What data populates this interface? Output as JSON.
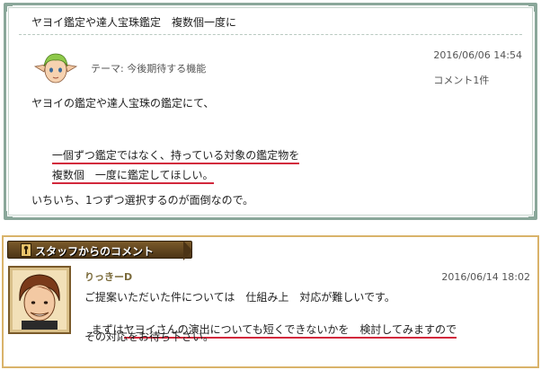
{
  "post": {
    "title": "ヤヨイ鑑定や達人宝珠鑑定　複数個一度に",
    "date": "2016/06/06 14:54",
    "comments": "コメント1件",
    "theme_label": "テーマ:",
    "theme_value": "今後期待する機能",
    "lines": [
      "ヤヨイの鑑定や達人宝珠の鑑定にて、",
      "一個ずつ鑑定ではなく、持っている対象の鑑定物を",
      "複数個　一度に鑑定してほしい。",
      "いちいち、1つずつ選択するのが面倒なので。"
    ]
  },
  "staff": {
    "banner": "スタッフからのコメント",
    "name": "りっきーD",
    "date": "2016/06/14 18:02",
    "lines": [
      "ご提案いただいた件については　仕組み上　対応が難しいです。",
      "まずはヤヨイさんの演出についても短くできないかを　検討してみますので",
      "その対応をお待ち下さい。"
    ]
  },
  "colors": {
    "frame_green": "#8aa79a",
    "frame_gold": "#d9b36a",
    "underline_red": "#d2283c",
    "banner_brown": "#4c3415"
  }
}
